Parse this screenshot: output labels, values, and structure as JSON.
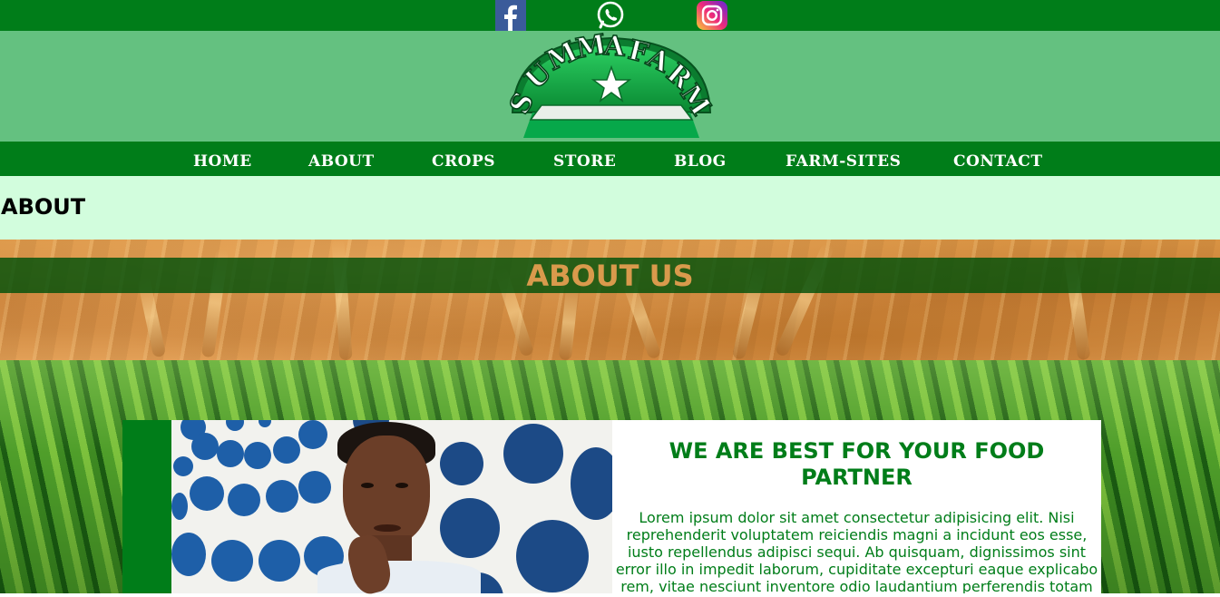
{
  "social": {
    "facebook": "facebook-icon",
    "whatsapp": "whatsapp-icon",
    "instagram": "instagram-icon"
  },
  "logo": {
    "text": "SUMMA FARM",
    "colors": {
      "green": "#0d9a3c",
      "light": "#ffffff"
    }
  },
  "nav": {
    "items": [
      {
        "label": "HOME"
      },
      {
        "label": "ABOUT"
      },
      {
        "label": "CROPS"
      },
      {
        "label": "STORE"
      },
      {
        "label": "BLOG"
      },
      {
        "label": "FARM-SITES"
      },
      {
        "label": "CONTACT"
      }
    ]
  },
  "breadcrumb": {
    "title": "ABOUT"
  },
  "hero": {
    "title": "ABOUT US"
  },
  "about": {
    "headline": "WE ARE BEST FOR YOUR FOOD PARTNER",
    "body": "Lorem ipsum dolor sit amet consectetur adipisicing elit. Nisi reprehenderit voluptatem reiciendis magni a incidunt eos esse, iusto repellendus adipisci sequi. Ab quisquam, dignissimos sint error illo in impedit laborum, cupiditate excepturi eaque explicabo rem, vitae nesciunt inventore odio laudantium perferendis totam"
  },
  "colors": {
    "brand_green": "#007d19",
    "logo_band": "#64c180",
    "crumb_band": "#d2fddd",
    "hero_title": "#d99a4c"
  }
}
